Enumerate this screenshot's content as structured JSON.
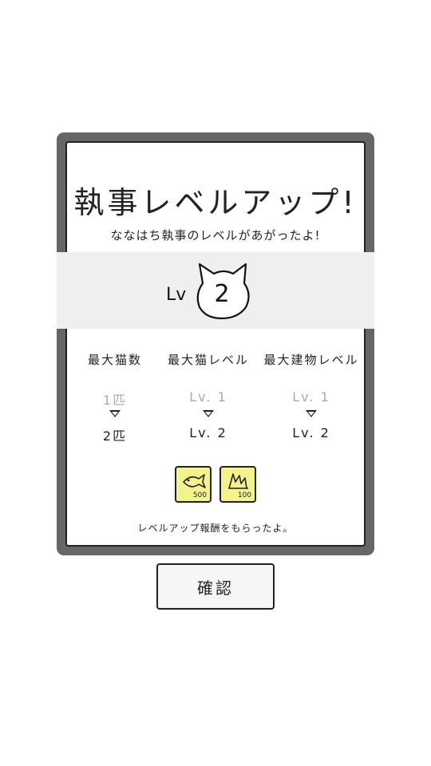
{
  "dialog": {
    "title": "執事レベルアップ!",
    "subtitle": "ななはち執事のレベルがあがったよ!",
    "level_prefix": "Lv",
    "level": "2",
    "stats": [
      {
        "header": "最大猫数",
        "old": "1匹",
        "new": "2匹"
      },
      {
        "header": "最大猫レベル",
        "old": "Lv. 1",
        "new": "Lv. 2"
      },
      {
        "header": "最大建物レベル",
        "old": "Lv. 1",
        "new": "Lv. 2"
      }
    ],
    "rewards": [
      {
        "icon": "fish-icon",
        "amount": "500"
      },
      {
        "icon": "grass-icon",
        "amount": "100"
      }
    ],
    "reward_message": "レベルアップ報酬をもらったよ。",
    "colors": {
      "frame": "#666666",
      "reward_bg": "#f4f28a",
      "band": "#efefef"
    }
  },
  "confirm_button": {
    "label": "確認"
  }
}
